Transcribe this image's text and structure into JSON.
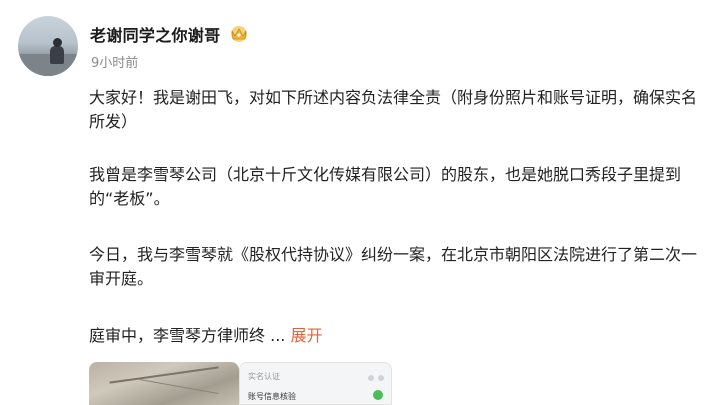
{
  "post": {
    "author": {
      "name": "老谢同学之你谢哥",
      "badge_icon": "crown-badge-icon",
      "timestamp": "9小时前"
    },
    "paragraphs": [
      "大家好！我是谢田飞，对如下所述内容负法律全责（附身份照片和账号证明，确保实名所发）",
      "我曾是李雪琴公司（北京十斤文化传媒有限公司）的股东，也是她脱口秀段子里提到的“老板”。",
      "今日，我与李雪琴就《股权代持协议》纠纷一案，在北京市朝阳区法院进行了第二次一审开庭。",
      "庭审中，李雪琴方律师终"
    ],
    "truncation": "...",
    "expand_label": "展开",
    "attachments": {
      "image2_lines": [
        "实名认证",
        "账号信息核验"
      ]
    },
    "colors": {
      "accent": "#e8603a",
      "badge": "#f0b43c"
    }
  }
}
